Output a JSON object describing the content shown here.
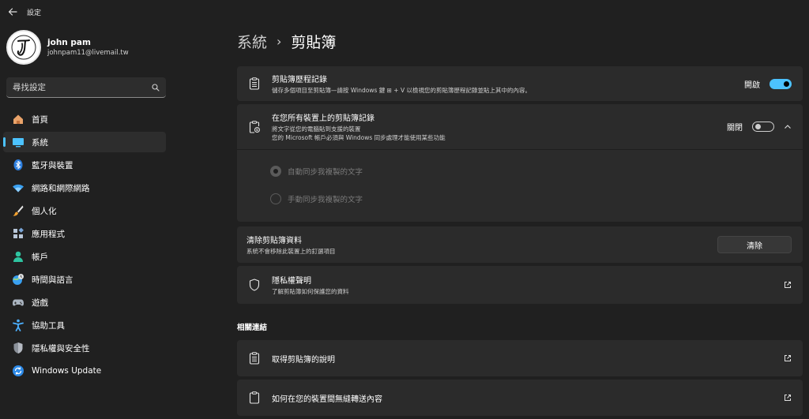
{
  "window": {
    "title": "設定"
  },
  "profile": {
    "name": "john pam",
    "email": "johnpam11@livemail.tw"
  },
  "search": {
    "placeholder": "尋找設定"
  },
  "sidebar": {
    "items": [
      {
        "label": "首頁",
        "icon": "home-icon"
      },
      {
        "label": "系統",
        "icon": "system-icon",
        "active": true
      },
      {
        "label": "藍牙與裝置",
        "icon": "bluetooth-icon"
      },
      {
        "label": "網路和網際網路",
        "icon": "wifi-icon"
      },
      {
        "label": "個人化",
        "icon": "brush-icon"
      },
      {
        "label": "應用程式",
        "icon": "apps-icon"
      },
      {
        "label": "帳戶",
        "icon": "account-icon"
      },
      {
        "label": "時間與語言",
        "icon": "globe-clock-icon"
      },
      {
        "label": "遊戲",
        "icon": "gamepad-icon"
      },
      {
        "label": "協助工具",
        "icon": "accessibility-icon"
      },
      {
        "label": "隱私權與安全性",
        "icon": "shield-icon"
      },
      {
        "label": "Windows Update",
        "icon": "update-icon"
      }
    ]
  },
  "breadcrumb": {
    "parent": "系統",
    "separator": "›",
    "current": "剪貼簿"
  },
  "history": {
    "title": "剪貼簿歷程記錄",
    "subtitle": "儲存多個項目至剪貼簿—請按 Windows 鍵 ⊞ + V 以檢視您的剪貼簿歷程記錄並貼上其中的內容。",
    "state_label": "開啟",
    "on": true
  },
  "sync": {
    "title": "在您所有裝置上的剪貼簿記錄",
    "subtitle1": "將文字從您的電腦貼到支援的裝置",
    "subtitle2": "您的 Microsoft 帳戶必須與 Windows 同步處理才能使用某些功能",
    "state_label": "關閉",
    "on": false,
    "options": [
      {
        "label": "自動同步我複製的文字",
        "checked": true
      },
      {
        "label": "手動同步我複製的文字",
        "checked": false
      }
    ]
  },
  "clear": {
    "title": "清除剪貼簿資料",
    "subtitle": "系統不會移除此裝置上的釘選項目",
    "button_label": "清除"
  },
  "privacy": {
    "title": "隱私權聲明",
    "subtitle": "了解剪貼簿如何保護您的資料"
  },
  "related": {
    "heading": "相關連結",
    "links": [
      {
        "label": "取得剪貼簿的說明"
      },
      {
        "label": "如何在您的裝置間無縫轉送內容"
      }
    ]
  },
  "colors": {
    "accent": "#4cc2ff",
    "background": "#202020",
    "card": "#2b2b2b"
  }
}
